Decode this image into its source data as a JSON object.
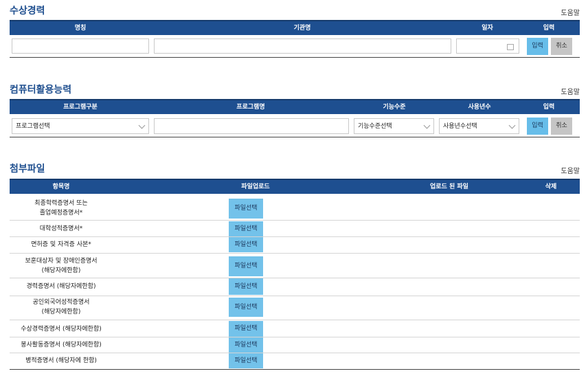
{
  "awards": {
    "title": "수상경력",
    "help": "도움말",
    "headers": [
      "명칭",
      "기관명",
      "일자",
      "입력"
    ],
    "input_label": "입력",
    "cancel_label": "취소"
  },
  "computer": {
    "title": "컴퓨터활용능력",
    "help": "도움말",
    "headers": [
      "프로그램구분",
      "프로그램명",
      "기능수준",
      "사용년수",
      "입력"
    ],
    "program_select": "프로그램선택",
    "level_select": "기능수준선택",
    "years_select": "사용년수선택",
    "input_label": "입력",
    "cancel_label": "취소"
  },
  "attach": {
    "title": "첨부파일",
    "help": "도움말",
    "headers": [
      "항목명",
      "파일업로드",
      "업로드 된 파일",
      "삭제"
    ],
    "file_button": "파일선택",
    "items": [
      {
        "l1": "최종학력증명서 또는",
        "l2": "졸업예정증명서*"
      },
      {
        "l1": "대학성적증명서*",
        "l2": ""
      },
      {
        "l1": "면허증 및 자격증 사본*",
        "l2": ""
      },
      {
        "l1": "보훈대상자 및 장애인증명서",
        "l2": "(해당자에한함)"
      },
      {
        "l1": "경력증명서 (해당자에한함)",
        "l2": ""
      },
      {
        "l1": "공인외국어성적증명서",
        "l2": "(해당자에한함)"
      },
      {
        "l1": "수상경력증명서 (해당자에한함)",
        "l2": ""
      },
      {
        "l1": "봉사활동증명서 (해당자에한함)",
        "l2": ""
      },
      {
        "l1": "병적증명서 (해당자에 한함)",
        "l2": ""
      }
    ]
  }
}
